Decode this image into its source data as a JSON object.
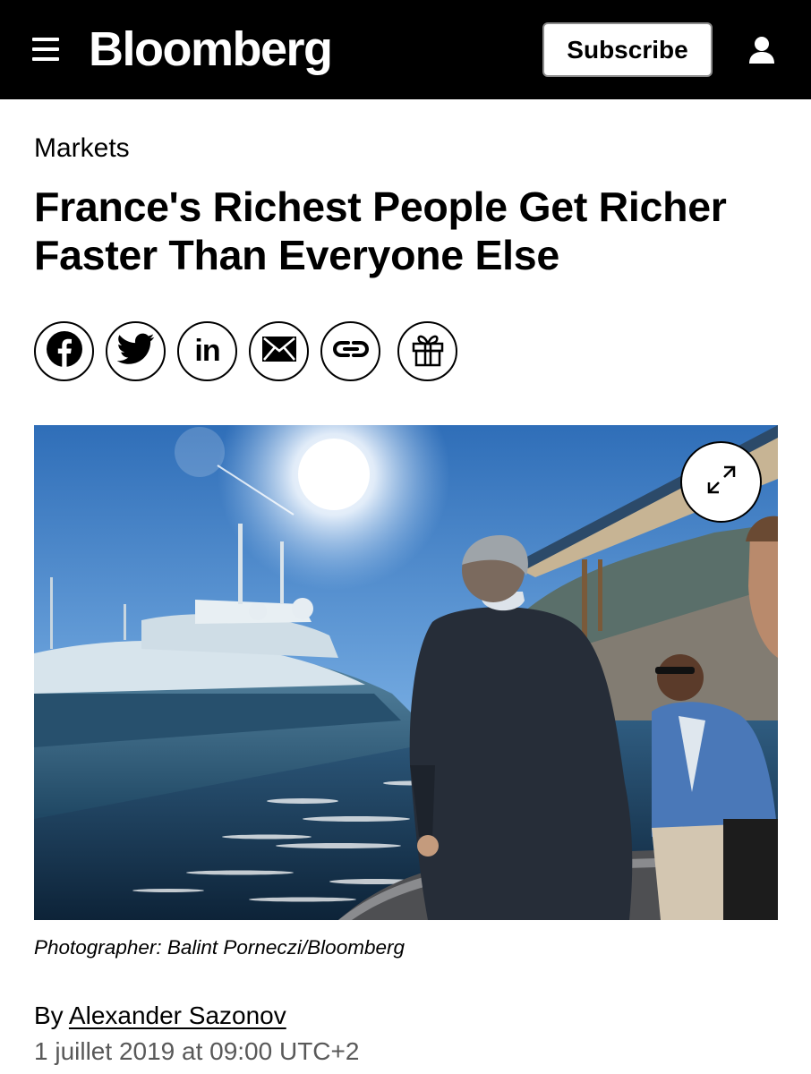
{
  "header": {
    "logo": "Bloomberg",
    "subscribe_label": "Subscribe",
    "background": "#000000"
  },
  "article": {
    "section": "Markets",
    "headline": "France's Richest People Get Richer Faster Than Everyone Else",
    "share": [
      {
        "name": "facebook",
        "icon": "facebook-icon"
      },
      {
        "name": "twitter",
        "icon": "twitter-icon"
      },
      {
        "name": "linkedin",
        "icon": "linkedin-icon",
        "label": "in"
      },
      {
        "name": "email",
        "icon": "envelope-icon"
      },
      {
        "name": "copy-link",
        "icon": "link-icon"
      },
      {
        "name": "gift",
        "icon": "gift-icon"
      }
    ],
    "photo": {
      "caption": "Photographer: Balint Porneczi/Bloomberg"
    },
    "byline": {
      "prefix": "By",
      "author": "Alexander Sazonov"
    },
    "date": "1 juillet 2019 at 09:00 UTC+2"
  }
}
